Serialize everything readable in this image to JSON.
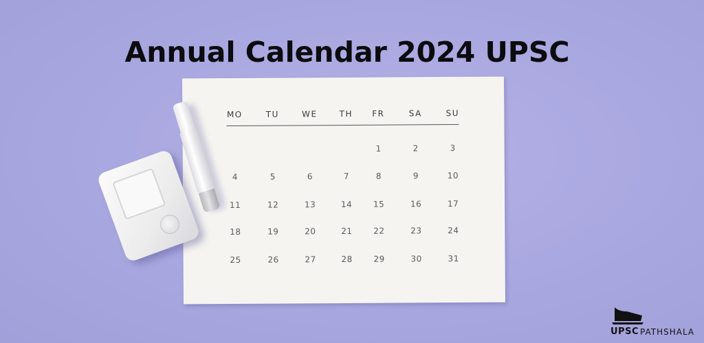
{
  "title": "Annual Calendar 2024 UPSC",
  "calendar": {
    "weekdays": [
      "MO",
      "TU",
      "WE",
      "TH",
      "FR",
      "SA",
      "SU"
    ],
    "rows": [
      [
        "",
        "",
        "",
        "",
        "1",
        "2",
        "3"
      ],
      [
        "4",
        "5",
        "6",
        "7",
        "8",
        "9",
        "10"
      ],
      [
        "11",
        "12",
        "13",
        "14",
        "15",
        "16",
        "17"
      ],
      [
        "18",
        "19",
        "20",
        "21",
        "22",
        "23",
        "24"
      ],
      [
        "25",
        "26",
        "27",
        "28",
        "29",
        "30",
        "31"
      ]
    ]
  },
  "objects": {
    "meter": "glucose-meter",
    "lancet": "lancet-pen"
  },
  "logo": {
    "upsc": "UPSC",
    "pathshala": "PATHSHALA"
  },
  "colors": {
    "background": "#aaa8e0",
    "paper": "#f5f4f1",
    "title": "#0c0c10"
  }
}
